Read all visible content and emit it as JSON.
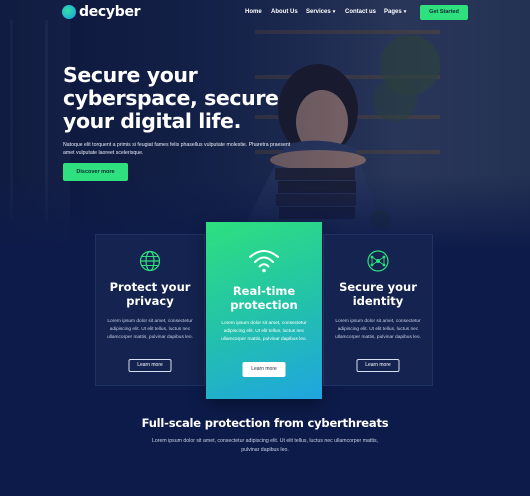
{
  "brand": {
    "name": "decyber"
  },
  "nav": {
    "items": [
      "Home",
      "About Us",
      "Services",
      "Contact us",
      "Pages"
    ],
    "cta": "Get Started"
  },
  "hero": {
    "title": "Secure your cyberspace, secure your digital life.",
    "subtitle": "Natoque elit torquent a primis si feugiat fames felis phasellus vulputate molestie. Pharetra praesent amet vulputate laoreet scelerisque.",
    "button": "Discover more"
  },
  "cards": [
    {
      "icon": "globe-icon",
      "title": "Protect your privacy",
      "text": "Lorem ipsum dolor sit amet, consectetur adipiscing elit. Ut elit tellus, luctus nec ullamcorper mattis, pulvinar dapibus leo.",
      "button": "Learn more"
    },
    {
      "icon": "wifi-icon",
      "title": "Real-time protection",
      "text": "Lorem ipsum dolor sit amet, consectetur adipiscing elit. Ut elit tellus, luctus nec ullamcorper mattis, pulvinar dapibus leo.",
      "button": "Learn more"
    },
    {
      "icon": "network-icon",
      "title": "Secure your identity",
      "text": "Lorem ipsum dolor sit amet, consectetur adipiscing elit. Ut elit tellus, luctus nec ullamcorper mattis, pulvinar dapibus leo.",
      "button": "Learn more"
    }
  ],
  "section": {
    "title": "Full-scale protection from cyberthreats",
    "text": "Lorem ipsum dolor sit amet, consectetur adipiscing elit. Ut elit tellus, luctus nec ullamcorper mattis, pulvinar dapibus leo."
  },
  "colors": {
    "accent": "#2ee07e",
    "navy": "#0d1b4a",
    "card": "#14234f",
    "gradient_end": "#1fa5e0"
  }
}
